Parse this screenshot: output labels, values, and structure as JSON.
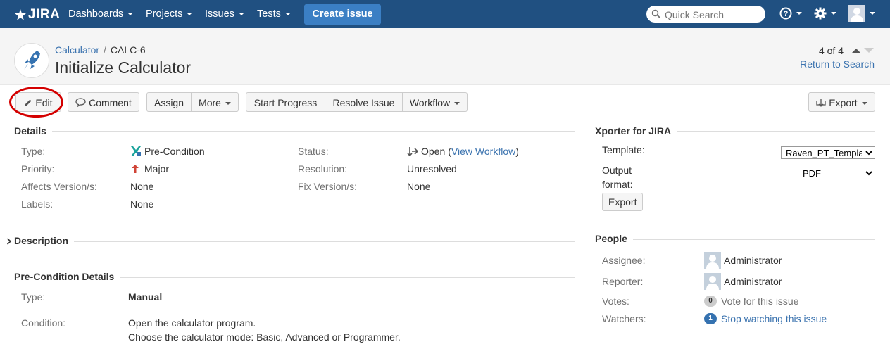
{
  "nav": {
    "logo": "JIRA",
    "menus": [
      "Dashboards",
      "Projects",
      "Issues",
      "Tests"
    ],
    "create_label": "Create issue",
    "search_placeholder": "Quick Search"
  },
  "header": {
    "project": "Calculator",
    "issue_key": "CALC-6",
    "title": "Initialize Calculator",
    "pager": "4 of 4",
    "return_link": "Return to Search"
  },
  "toolbar": {
    "edit": "Edit",
    "comment": "Comment",
    "assign": "Assign",
    "more": "More",
    "start_progress": "Start Progress",
    "resolve": "Resolve Issue",
    "workflow": "Workflow",
    "export": "Export"
  },
  "details": {
    "title": "Details",
    "type_label": "Type:",
    "type_value": "Pre-Condition",
    "priority_label": "Priority:",
    "priority_value": "Major",
    "affects_label": "Affects Version/s:",
    "affects_value": "None",
    "labels_label": "Labels:",
    "labels_value": "None",
    "status_label": "Status:",
    "status_value": "Open",
    "view_workflow": "View Workflow",
    "resolution_label": "Resolution:",
    "resolution_value": "Unresolved",
    "fix_label": "Fix Version/s:",
    "fix_value": "None"
  },
  "description": {
    "title": "Description"
  },
  "precondition": {
    "title": "Pre-Condition Details",
    "type_label": "Type:",
    "type_value": "Manual",
    "condition_label": "Condition:",
    "condition_line1": "Open the calculator program.",
    "condition_line2": "Choose the calculator mode: Basic, Advanced or Programmer."
  },
  "xporter": {
    "title": "Xporter for JIRA",
    "template_label": "Template:",
    "template_value": "Raven_PT_Templa",
    "output_label_1": "Output",
    "output_label_2": "format:",
    "output_value": "PDF",
    "export_btn": "Export"
  },
  "people": {
    "title": "People",
    "assignee_label": "Assignee:",
    "assignee": "Administrator",
    "reporter_label": "Reporter:",
    "reporter": "Administrator",
    "votes_label": "Votes:",
    "votes_count": "0",
    "vote_link": "Vote for this issue",
    "watchers_label": "Watchers:",
    "watchers_count": "1",
    "watch_link": "Stop watching this issue"
  },
  "colors": {
    "nav_bg": "#205081",
    "create_btn": "#3b7fc4",
    "link": "#3b73af",
    "highlight_circle": "#d40000"
  }
}
